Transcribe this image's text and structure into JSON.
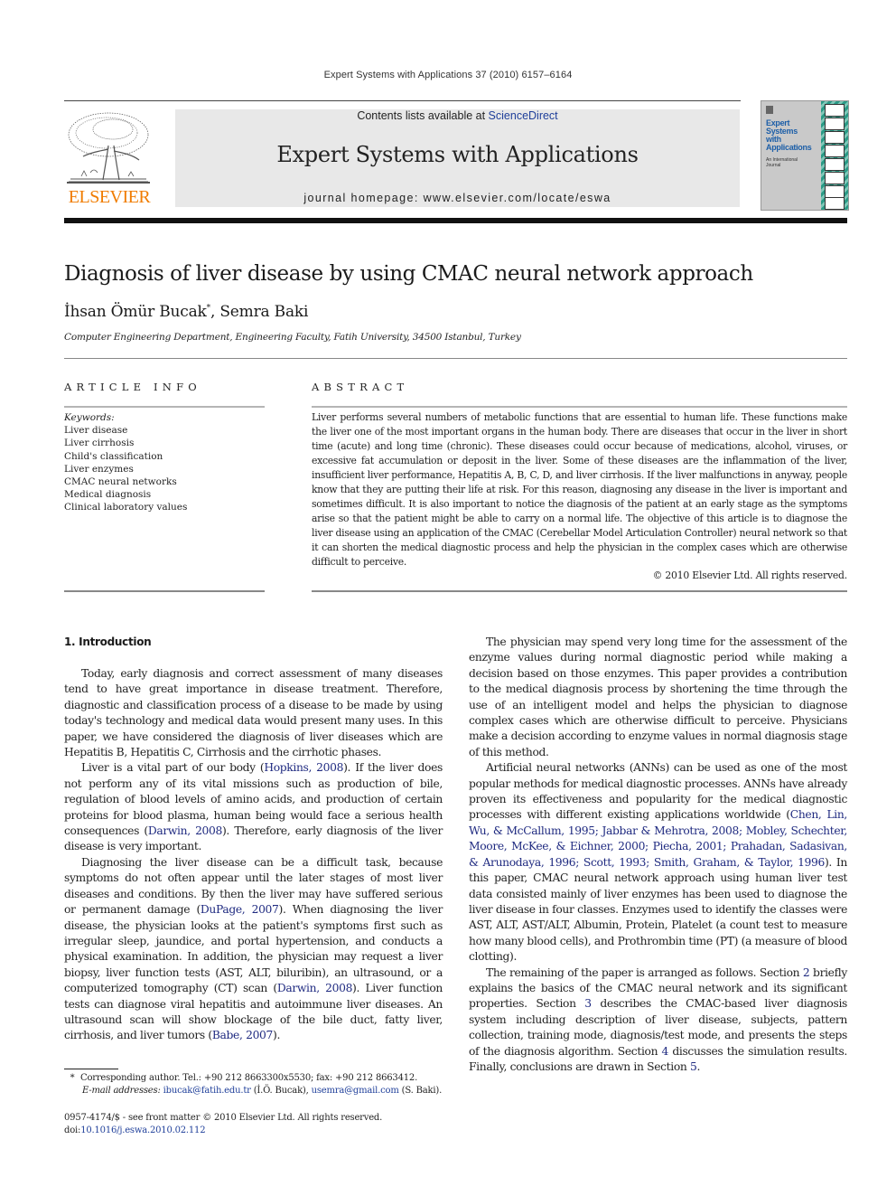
{
  "running_head": "Expert Systems with Applications 37 (2010) 6157–6164",
  "masthead": {
    "publisher_logo_text": "ELSEVIER",
    "contents_prefix": "Contents lists available at ",
    "contents_link": "ScienceDirect",
    "journal_title": "Expert Systems with Applications",
    "homepage_prefix": "journal homepage: ",
    "homepage_url": "www.elsevier.com/locate/eswa",
    "cover": {
      "title_lines": [
        "Expert",
        "Systems",
        "with",
        "Applications"
      ],
      "subtitle_lines": [
        "An International",
        "Journal"
      ]
    },
    "colors": {
      "elsevier_orange": "#f07c00",
      "link_blue": "#1f3f9a",
      "masthead_gray": "#e8e8e8"
    }
  },
  "article": {
    "title": "Diagnosis of liver disease by using CMAC neural network approach",
    "authors": [
      {
        "name": "İhsan Ömür Bucak",
        "mark": "*"
      },
      {
        "name": "Semra Baki",
        "mark": ""
      }
    ],
    "author_separator": ", ",
    "affiliation": "Computer Engineering Department, Engineering Faculty, Fatih University, 34500 Istanbul, Turkey"
  },
  "article_info": {
    "heading": "ARTICLE INFO",
    "keywords_label": "Keywords:",
    "keywords": [
      "Liver disease",
      "Liver cirrhosis",
      "Child's classification",
      "Liver enzymes",
      "CMAC neural networks",
      "Medical diagnosis",
      "Clinical laboratory values"
    ]
  },
  "abstract": {
    "heading": "ABSTRACT",
    "text": "Liver performs several numbers of metabolic functions that are essential to human life. These functions make the liver one of the most important organs in the human body. There are diseases that occur in the liver in short time (acute) and long time (chronic). These diseases could occur because of medications, alcohol, viruses, or excessive fat accumulation or deposit in the liver. Some of these diseases are the inflammation of the liver, insufficient liver performance, Hepatitis A, B, C, D, and liver cirrhosis. If the liver malfunctions in anyway, people know that they are putting their life at risk. For this reason, diagnosing any disease in the liver is important and sometimes difficult. It is also important to notice the diagnosis of the patient at an early stage as the symptoms arise so that the patient might be able to carry on a normal life. The objective of this article is to diagnose the liver disease using an application of the CMAC (Cerebellar Model Articulation Controller) neural network so that it can shorten the medical diagnostic process and help the physician in the complex cases which are otherwise difficult to perceive.",
    "copyright": "© 2010 Elsevier Ltd. All rights reserved."
  },
  "introduction": {
    "heading": "1. Introduction",
    "left_paragraphs": [
      [
        {
          "t": "Today, early diagnosis and correct assessment of many diseases tend to have great importance in disease treatment. Therefore, diagnostic and classification process of a disease to be made by using today's technology and medical data would present many uses. In this paper, we have considered the diagnosis of liver diseases which are Hepatitis B, Hepatitis C, Cirrhosis and the cirrhotic phases."
        }
      ],
      [
        {
          "t": "Liver is a vital part of our body ("
        },
        {
          "t": "Hopkins, 2008",
          "link": true
        },
        {
          "t": "). If the liver does not perform any of its vital missions such as production of bile, regulation of blood levels of amino acids, and production of certain proteins for blood plasma, human being would face a serious health consequences ("
        },
        {
          "t": "Darwin, 2008",
          "link": true
        },
        {
          "t": "). Therefore, early diagnosis of the liver disease is very important."
        }
      ],
      [
        {
          "t": "Diagnosing the liver disease can be a difficult task, because symptoms do not often appear until the later stages of most liver diseases and conditions. By then the liver may have suffered serious or permanent damage ("
        },
        {
          "t": "DuPage, 2007",
          "link": true
        },
        {
          "t": "). When diagnosing the liver disease, the physician looks at the patient's symptoms first such as irregular sleep, jaundice, and portal hypertension, and conducts a physical examination. In addition, the physician may request a liver biopsy, liver function tests (AST, ALT, biluribin), an ultrasound, or a computerized tomography (CT) scan ("
        },
        {
          "t": "Darwin, 2008",
          "link": true
        },
        {
          "t": "). Liver function tests can diagnose viral hepatitis and autoimmune liver diseases. An ultrasound scan will show blockage of the bile duct, fatty liver, cirrhosis, and liver tumors ("
        },
        {
          "t": "Babe, 2007",
          "link": true
        },
        {
          "t": ")."
        }
      ]
    ],
    "right_paragraphs": [
      [
        {
          "t": "The physician may spend very long time for the assessment of the enzyme values during normal diagnostic period while making a decision based on those enzymes. This paper provides a contribution to the medical diagnosis process by shortening the time through the use of an intelligent model and helps the physician to diagnose complex cases which are otherwise difficult to perceive. Physicians make a decision according to enzyme values in normal diagnosis stage of this method."
        }
      ],
      [
        {
          "t": "Artificial neural networks (ANNs) can be used as one of the most popular methods for medical diagnostic processes. ANNs have already proven its effectiveness and popularity for the medical diagnostic processes with different existing applications worldwide ("
        },
        {
          "t": "Chen, Lin, Wu, & McCallum, 1995; Jabbar & Mehrotra, 2008; Mobley, Schechter, Moore, McKee, & Eichner, 2000; Piecha, 2001; Prahadan, Sadasivan, & Arunodaya, 1996; Scott, 1993; Smith, Graham, & Taylor, 1996",
          "link": true
        },
        {
          "t": "). In this paper, CMAC neural network approach using human liver test data consisted mainly of liver enzymes has been used to diagnose the liver disease in four classes. Enzymes used to identify the classes were AST, ALT, AST/ALT, Albumin, Protein, Platelet (a count test to measure how many blood cells), and Prothrombin time (PT) (a measure of blood clotting)."
        }
      ],
      [
        {
          "t": "The remaining of the paper is arranged as follows. Section "
        },
        {
          "t": "2",
          "link": true
        },
        {
          "t": " briefly explains the basics of the CMAC neural network and its significant properties. Section "
        },
        {
          "t": "3",
          "link": true
        },
        {
          "t": " describes the CMAC-based liver diagnosis system including description of liver disease, subjects, pattern collection, training mode, diagnosis/test mode, and presents the steps of the diagnosis algorithm. Section "
        },
        {
          "t": "4",
          "link": true
        },
        {
          "t": " discusses the simulation results. Finally, conclusions are drawn in Section "
        },
        {
          "t": "5",
          "link": true
        },
        {
          "t": "."
        }
      ]
    ]
  },
  "footnote": {
    "mark": "*",
    "corresponding": "Corresponding author. Tel.: +90 212 8663300x5530; fax: +90 212 8663412.",
    "email_label": "E-mail addresses:",
    "emails": [
      {
        "address": "ibucak@fatih.edu.tr",
        "who": "(İ.Ö. Bucak)"
      },
      {
        "address": "usemra@gmail.com",
        "who": "(S. Baki)."
      }
    ]
  },
  "front_matter": {
    "issn_line": "0957-4174/$ - see front matter © 2010 Elsevier Ltd. All rights reserved.",
    "doi_prefix": "doi:",
    "doi": "10.1016/j.eswa.2010.02.112"
  }
}
